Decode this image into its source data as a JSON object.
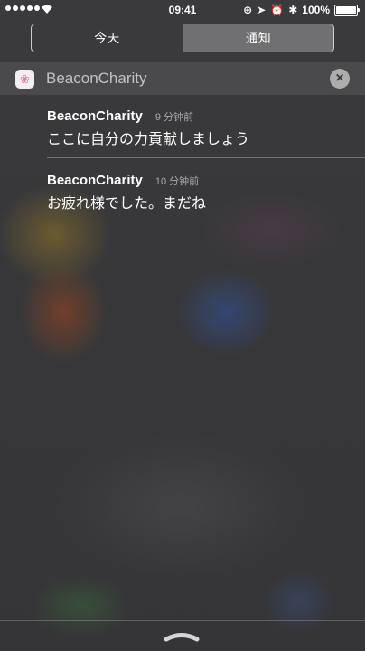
{
  "status_bar": {
    "time": "09:41",
    "battery": "100%"
  },
  "tabs": [
    {
      "label": "今天",
      "selected": false
    },
    {
      "label": "通知",
      "selected": true
    }
  ],
  "group": {
    "app_name": "BeaconCharity",
    "notifications": [
      {
        "title": "BeaconCharity",
        "time": "9 分钟前",
        "message": "ここに自分の力貢献しましょう"
      },
      {
        "title": "BeaconCharity",
        "time": "10 分钟前",
        "message": "お疲れ様でした。まだね"
      }
    ]
  }
}
